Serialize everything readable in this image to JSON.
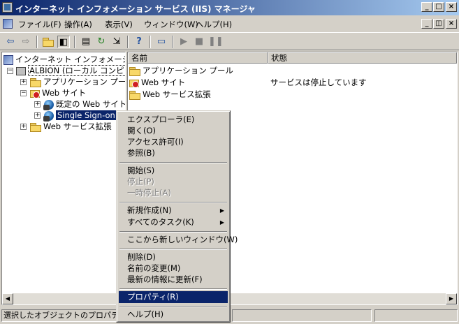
{
  "window": {
    "title": "インターネット インフォメーション サービス (IIS) マネージャ"
  },
  "menu": [
    "ファイル(F)",
    "操作(A)",
    "表示(V)",
    "ウィンドウ(W)",
    "ヘルプ(H)"
  ],
  "tree": {
    "root": "インターネット インフォメーション",
    "server": "ALBION (ローカル コンピュ",
    "app_pools": "アプリケーション プール",
    "web_sites": "Web サイト",
    "default_site": "既定の Web サイト",
    "sso_site": "Single Sign-on W",
    "web_ext": "Web サービス拡張"
  },
  "list": {
    "columns": [
      "名前",
      "状態"
    ],
    "rows": [
      {
        "name": "アプリケーション プール",
        "status": ""
      },
      {
        "name": "Web サイト",
        "status": "サービスは停止しています"
      },
      {
        "name": "Web サービス拡張",
        "status": ""
      }
    ]
  },
  "context_menu": {
    "explore": "エクスプローラ(E)",
    "open": "開く(O)",
    "permissions": "アクセス許可(I)",
    "browse": "参照(B)",
    "start": "開始(S)",
    "stop": "停止(P)",
    "pause": "一時停止(A)",
    "new": "新規作成(N)",
    "all_tasks": "すべてのタスク(K)",
    "new_window": "ここから新しいウィンドウ(W)",
    "delete": "削除(D)",
    "rename": "名前の変更(M)",
    "refresh": "最新の情報に更新(F)",
    "properties": "プロパティ(R)",
    "help": "ヘルプ(H)"
  },
  "status": {
    "text": "選択したオブジェクトのプロパティ シ"
  }
}
